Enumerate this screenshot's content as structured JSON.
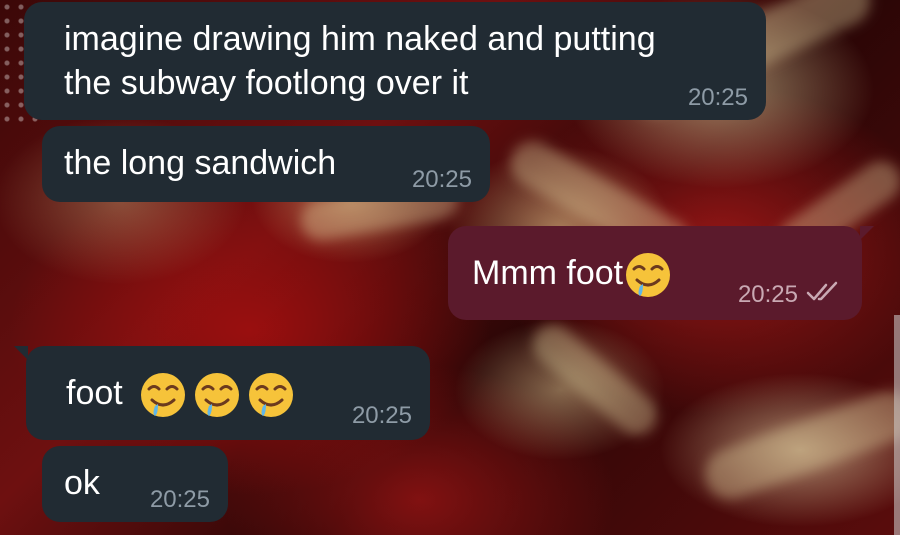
{
  "messages": [
    {
      "direction": "incoming",
      "lines": [
        "imagine drawing him naked and putting",
        "the subway footlong over it"
      ],
      "time": "20:25"
    },
    {
      "direction": "incoming",
      "text": "the long sandwich",
      "time": "20:25"
    },
    {
      "direction": "outgoing",
      "text": "Mmm foot",
      "emoji": [
        "drooling-face"
      ],
      "time": "20:25",
      "status": "read"
    },
    {
      "direction": "incoming",
      "text": "foot",
      "emoji": [
        "drooling-face",
        "drooling-face",
        "drooling-face"
      ],
      "time": "20:25"
    },
    {
      "direction": "incoming",
      "text": "ok",
      "time": "20:25"
    }
  ],
  "colors": {
    "incoming_bubble": "#212b33",
    "outgoing_bubble": "#5b1a2c",
    "text": "#ffffff",
    "incoming_time": "#8e9ba6",
    "outgoing_time": "#c9a9b3"
  }
}
